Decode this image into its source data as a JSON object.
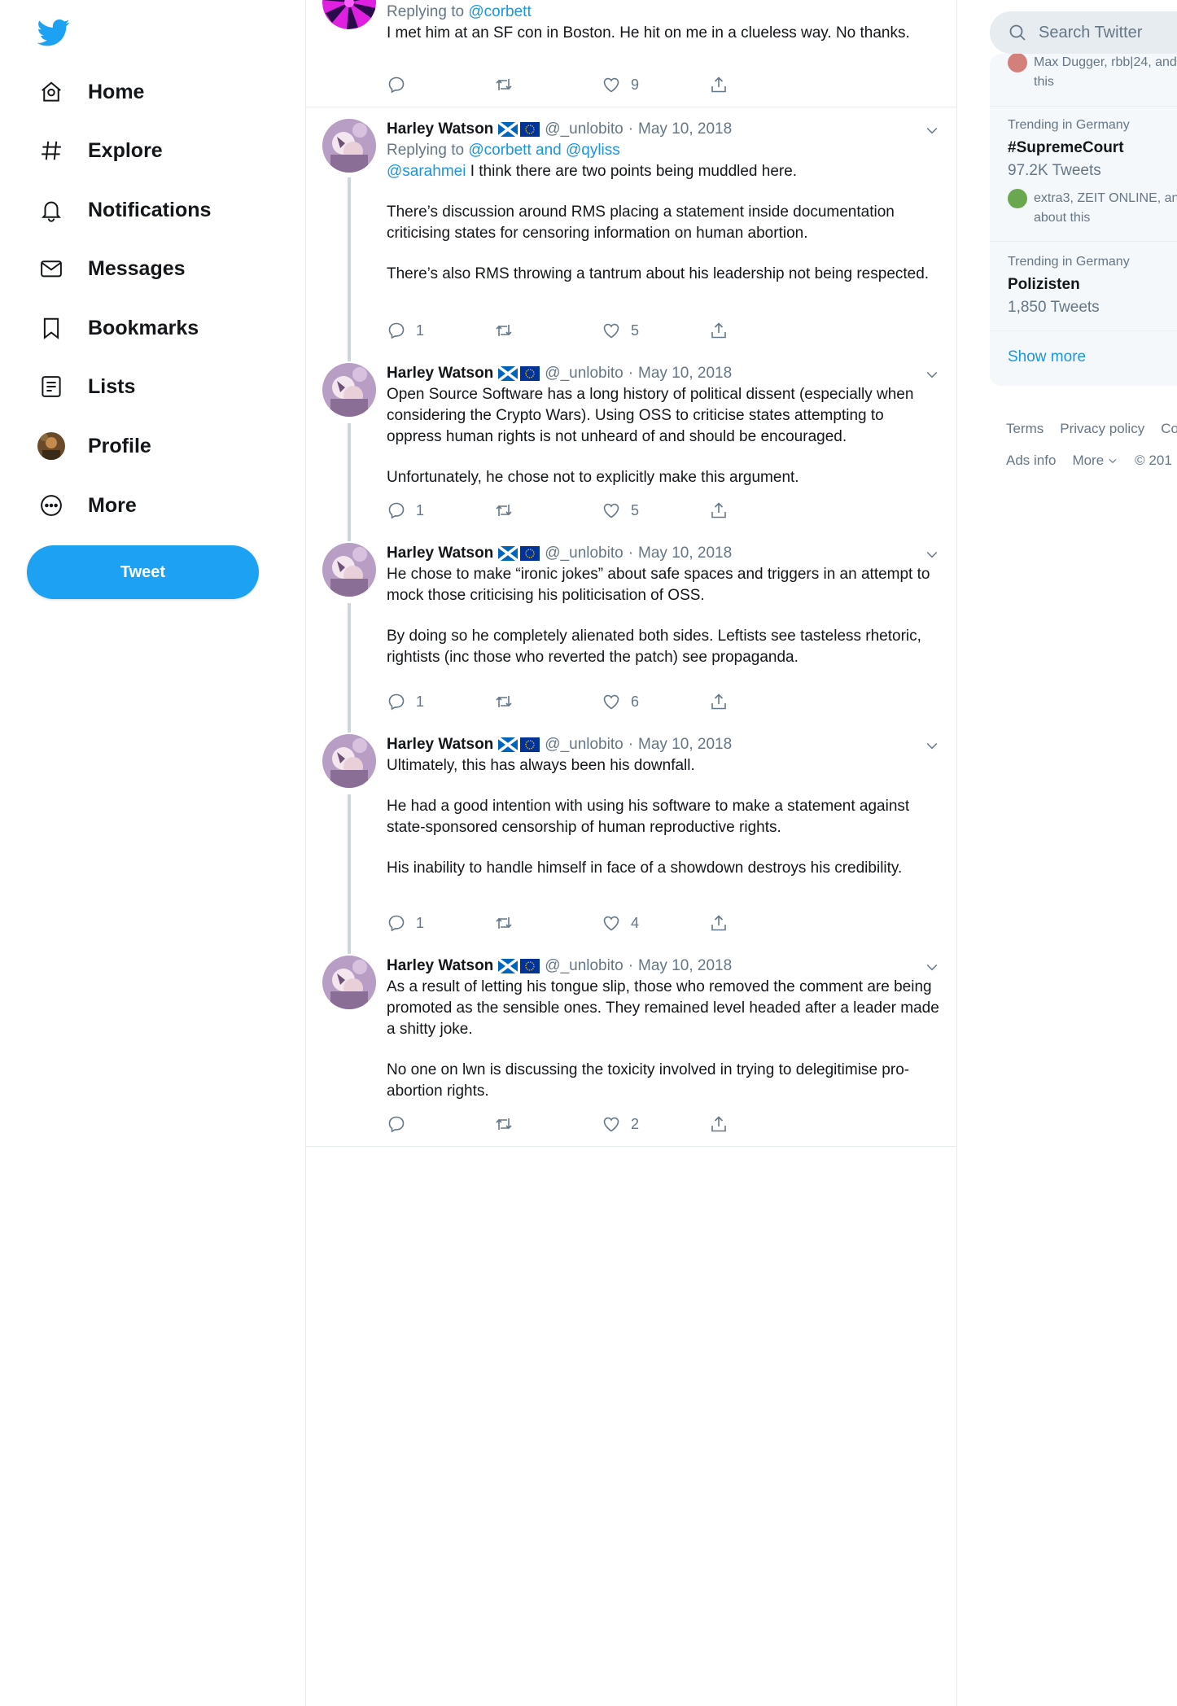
{
  "nav": {
    "items": [
      {
        "label": "Home"
      },
      {
        "label": "Explore"
      },
      {
        "label": "Notifications"
      },
      {
        "label": "Messages"
      },
      {
        "label": "Bookmarks"
      },
      {
        "label": "Lists"
      },
      {
        "label": "Profile"
      },
      {
        "label": "More"
      }
    ],
    "tweet_button": "Tweet"
  },
  "top_tweet": {
    "replying_prefix": "Replying to",
    "replying_to": "@corbett",
    "text": "I met him at an SF con in Boston. He hit on me in a clueless way. No thanks.",
    "replies": "",
    "retweets": "",
    "likes": "9"
  },
  "thread": {
    "name": "Harley Watson",
    "handle": "@_unlobito",
    "dot": "·",
    "date": "May 10, 2018",
    "tweets": [
      {
        "replying_prefix": "Replying to",
        "replying_to": "@corbett and @qyliss",
        "mention": "@sarahmei",
        "p1": "I think there are two points being muddled here.",
        "p2": "There’s discussion around RMS placing a statement inside documentation criticising states for censoring information on human abortion.",
        "p3": "There’s also RMS throwing a tantrum about his leadership not being respected.",
        "replies": "1",
        "retweets": "",
        "likes": "5"
      },
      {
        "p1": "Open Source Software has a long history of political dissent (especially when considering the Crypto Wars). Using OSS to criticise states attempting to oppress human rights is not unheard of and should be encouraged.",
        "p2": "Unfortunately, he chose not to explicitly make this argument.",
        "replies": "1",
        "retweets": "",
        "likes": "5"
      },
      {
        "p1": "He chose to make “ironic jokes” about safe spaces and triggers in an attempt to mock those criticising his politicisation of OSS.",
        "p2": "By doing so he completely alienated both sides. Leftists see tasteless rhetoric, rightists (inc those who reverted the patch) see propaganda.",
        "replies": "1",
        "retweets": "",
        "likes": "6"
      },
      {
        "p1": "Ultimately, this has always been his downfall.",
        "p2": "He had a good intention with using his software to make a statement against state-sponsored censorship of human reproductive rights.",
        "p3": "His inability to handle himself in face of a showdown destroys his credibility.",
        "replies": "1",
        "retweets": "",
        "likes": "4"
      },
      {
        "p1": "As a result of letting his tongue slip, those who removed the comment are being promoted as the sensible ones. They remained level headed after a leader made a shitty joke.",
        "p2": "No one on lwn is discussing the toxicity involved in trying to delegitimise pro-abortion rights.",
        "replies": "",
        "retweets": "",
        "likes": "2"
      }
    ]
  },
  "sidebar": {
    "search_placeholder": "Search Twitter",
    "partial_people_line1": "Max Dugger, rbb|24, and",
    "partial_people_line2": "this",
    "trends": [
      {
        "context": "Trending in Germany",
        "topic": "#SupremeCourt",
        "count": "97.2K Tweets",
        "people_line1": "extra3, ZEIT ONLINE, and",
        "people_line2": "about this"
      },
      {
        "context": "Trending in Germany",
        "topic": "Polizisten",
        "count": "1,850 Tweets"
      }
    ],
    "show_more": "Show more"
  },
  "footer": {
    "row1": [
      "Terms",
      "Privacy policy",
      "Co"
    ],
    "row2_ads": "Ads info",
    "row2_more": "More",
    "row2_copy": "© 201"
  },
  "colors": {
    "accent": "#1da1f2",
    "link": "#1b95e0",
    "muted": "#657786",
    "thread_line": "#ccd6dd"
  }
}
